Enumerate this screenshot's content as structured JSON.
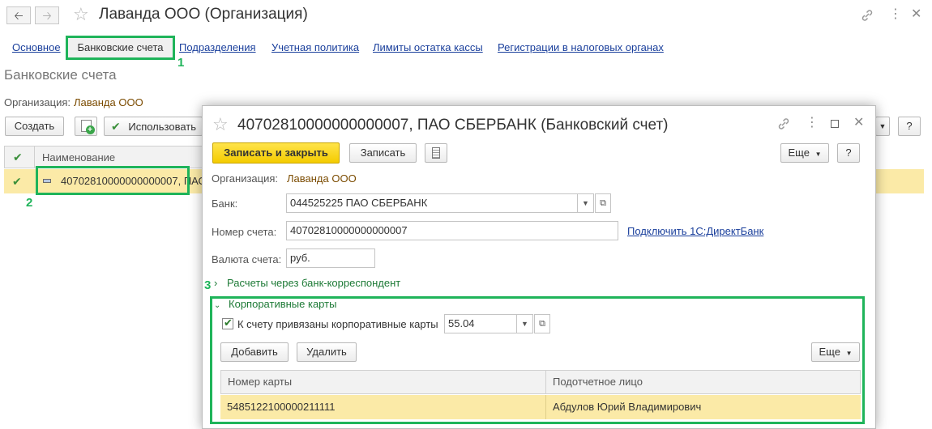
{
  "main": {
    "title": "Лаванда ООО (Организация)",
    "tabs": [
      "Основное",
      "Банковские счета",
      "Подразделения",
      "Учетная политика",
      "Лимиты остатка кассы",
      "Регистрации в налоговых органах"
    ],
    "section_title": "Банковские счета",
    "org_label": "Организация:",
    "org_value": "Лаванда ООО",
    "create_button": "Создать",
    "use_button": "Использовать",
    "column_name": "Наименование",
    "row_name": "40702810000000000007, ПАО СБЕРБАНК",
    "help_button": "?"
  },
  "annotations": [
    "1",
    "2",
    "3"
  ],
  "dialog": {
    "title": "40702810000000000007, ПАО СБЕРБАНК (Банковский счет)",
    "save_close_button": "Записать и закрыть",
    "save_button": "Записать",
    "more_button": "Еще",
    "help_button": "?",
    "org_label": "Организация:",
    "org_value": "Лаванда ООО",
    "bank_label": "Банк:",
    "bank_value": "044525225 ПАО СБЕРБАНК",
    "account_label": "Номер счета:",
    "account_value": "40702810000000000007",
    "directbank_link": "Подключить 1С:ДиректБанк",
    "currency_label": "Валюта счета:",
    "currency_value": "руб.",
    "correspondent_group": "Расчеты через банк-корреспондент",
    "cards_group": "Корпоративные карты",
    "cards_checkbox_label": "К счету привязаны корпоративные карты",
    "cards_account_value": "55.04",
    "add_button": "Добавить",
    "delete_button": "Удалить",
    "cards_more_button": "Еще",
    "cards_table": {
      "columns": [
        "Номер карты",
        "Подотчетное лицо"
      ],
      "rows": [
        [
          "5485122100000211111",
          "Абдулов Юрий Владимирович"
        ]
      ]
    }
  }
}
